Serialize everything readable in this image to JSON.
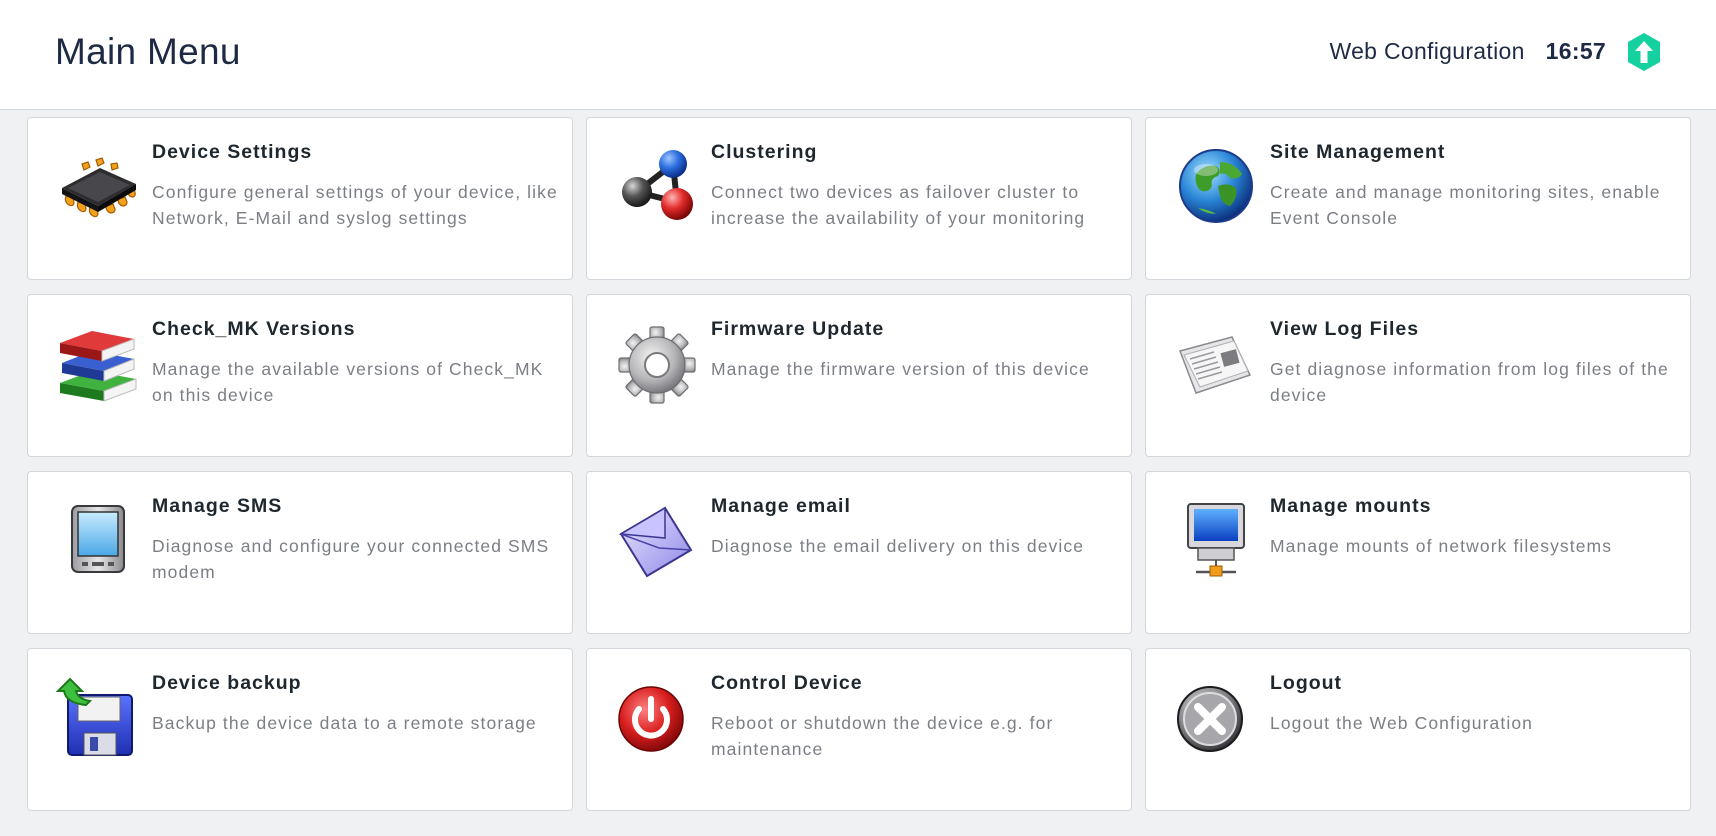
{
  "header": {
    "title": "Main Menu",
    "app_name": "Web Configuration",
    "clock": "16:57",
    "logo_icon": "checkmk-logo-icon",
    "logo_color": "#15d1a0"
  },
  "tiles": [
    {
      "title": "Device Settings",
      "desc": "Configure general settings of your device, like Network, E-Mail and syslog settings",
      "icon": "chip-icon"
    },
    {
      "title": "Clustering",
      "desc": "Connect two devices as failover cluster to increase the availability of your monitoring",
      "icon": "molecule-icon"
    },
    {
      "title": "Site Management",
      "desc": "Create and manage monitoring sites, enable Event Console",
      "icon": "globe-icon"
    },
    {
      "title": "Check_MK Versions",
      "desc": "Manage the available versions of Check_MK on this device",
      "icon": "books-icon"
    },
    {
      "title": "Firmware Update",
      "desc": "Manage the firmware version of this device",
      "icon": "gear-icon"
    },
    {
      "title": "View Log Files",
      "desc": "Get diagnose information from log files of the device",
      "icon": "newspaper-icon"
    },
    {
      "title": "Manage SMS",
      "desc": "Diagnose and configure your connected SMS modem",
      "icon": "pda-icon"
    },
    {
      "title": "Manage email",
      "desc": "Diagnose the email delivery on this device",
      "icon": "envelope-icon"
    },
    {
      "title": "Manage mounts",
      "desc": "Manage mounts of network filesystems",
      "icon": "network-computer-icon"
    },
    {
      "title": "Device backup",
      "desc": "Backup the device data to a remote storage",
      "icon": "backup-floppy-icon"
    },
    {
      "title": "Control Device",
      "desc": "Reboot or shutdown the device e.g. for maintenance",
      "icon": "power-icon"
    },
    {
      "title": "Logout",
      "desc": "Logout the Web Configuration",
      "icon": "logout-icon"
    }
  ]
}
